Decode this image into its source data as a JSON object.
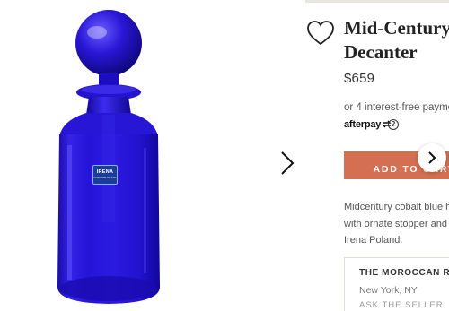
{
  "product": {
    "title_line1": "Mid-Century B",
    "title_line2": "Decanter",
    "price": "$659",
    "installments": "or 4 interest-free payme",
    "afterpay_brand": "afterpay",
    "info_glyph": "?",
    "add_to_cart": "ADD TO CART",
    "description": [
      "Midcentury cobalt blue h",
      "with ornate stopper and",
      "Irena Poland."
    ]
  },
  "label_sticker": {
    "brand": "IRENA",
    "fine_print": "HANDMADE CRYSTAL"
  },
  "seller": {
    "name": "THE MOROCCAN RO",
    "location": "New York, NY",
    "ask_label": "ASK THE SELLER"
  },
  "icons": {
    "favorite": "heart-icon",
    "photo_next": "chevron-right-icon",
    "carousel_next": "chevron-right-icon",
    "info": "info-circle-icon"
  },
  "colors": {
    "cobalt_glass": "#1e0dcc",
    "cart_button": "#d46f52",
    "title_text": "#222222",
    "border": "#e1ddd8"
  }
}
